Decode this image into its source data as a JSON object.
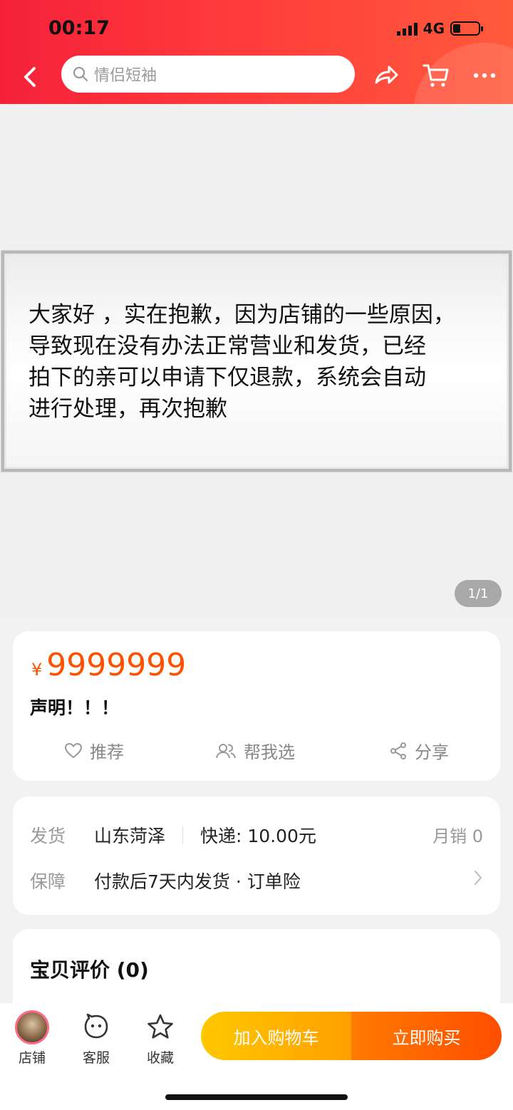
{
  "status_bar": {
    "time": "00:17",
    "network": "4G"
  },
  "header": {
    "search_placeholder": "情侣短袖"
  },
  "notice": {
    "lines": [
      "大家好 ，实在抱歉，因为店铺的一些原因，",
      "导致现在没有办法正常营业和发货，已经",
      "拍下的亲可以申请下仅退款，系统会自动",
      "进行处理，再次抱歉"
    ]
  },
  "gallery": {
    "page_indicator": "1/1"
  },
  "product": {
    "currency_symbol": "¥",
    "price": "9999999",
    "title": "声明！！！",
    "actions": {
      "recommend": "推荐",
      "help_choose": "帮我选",
      "share": "分享"
    }
  },
  "shipping": {
    "ship_label": "发货",
    "origin": "山东菏泽",
    "express": "快递: 10.00元",
    "monthly_sales": "月销 0",
    "guarantee_label": "保障",
    "guarantee_value": "付款后7天内发货 · 订单险"
  },
  "reviews": {
    "title": "宝贝评价 (0)"
  },
  "bottom_bar": {
    "shop": "店铺",
    "service": "客服",
    "favorite": "收藏",
    "add_to_cart": "加入购物车",
    "buy_now": "立即购买"
  }
}
